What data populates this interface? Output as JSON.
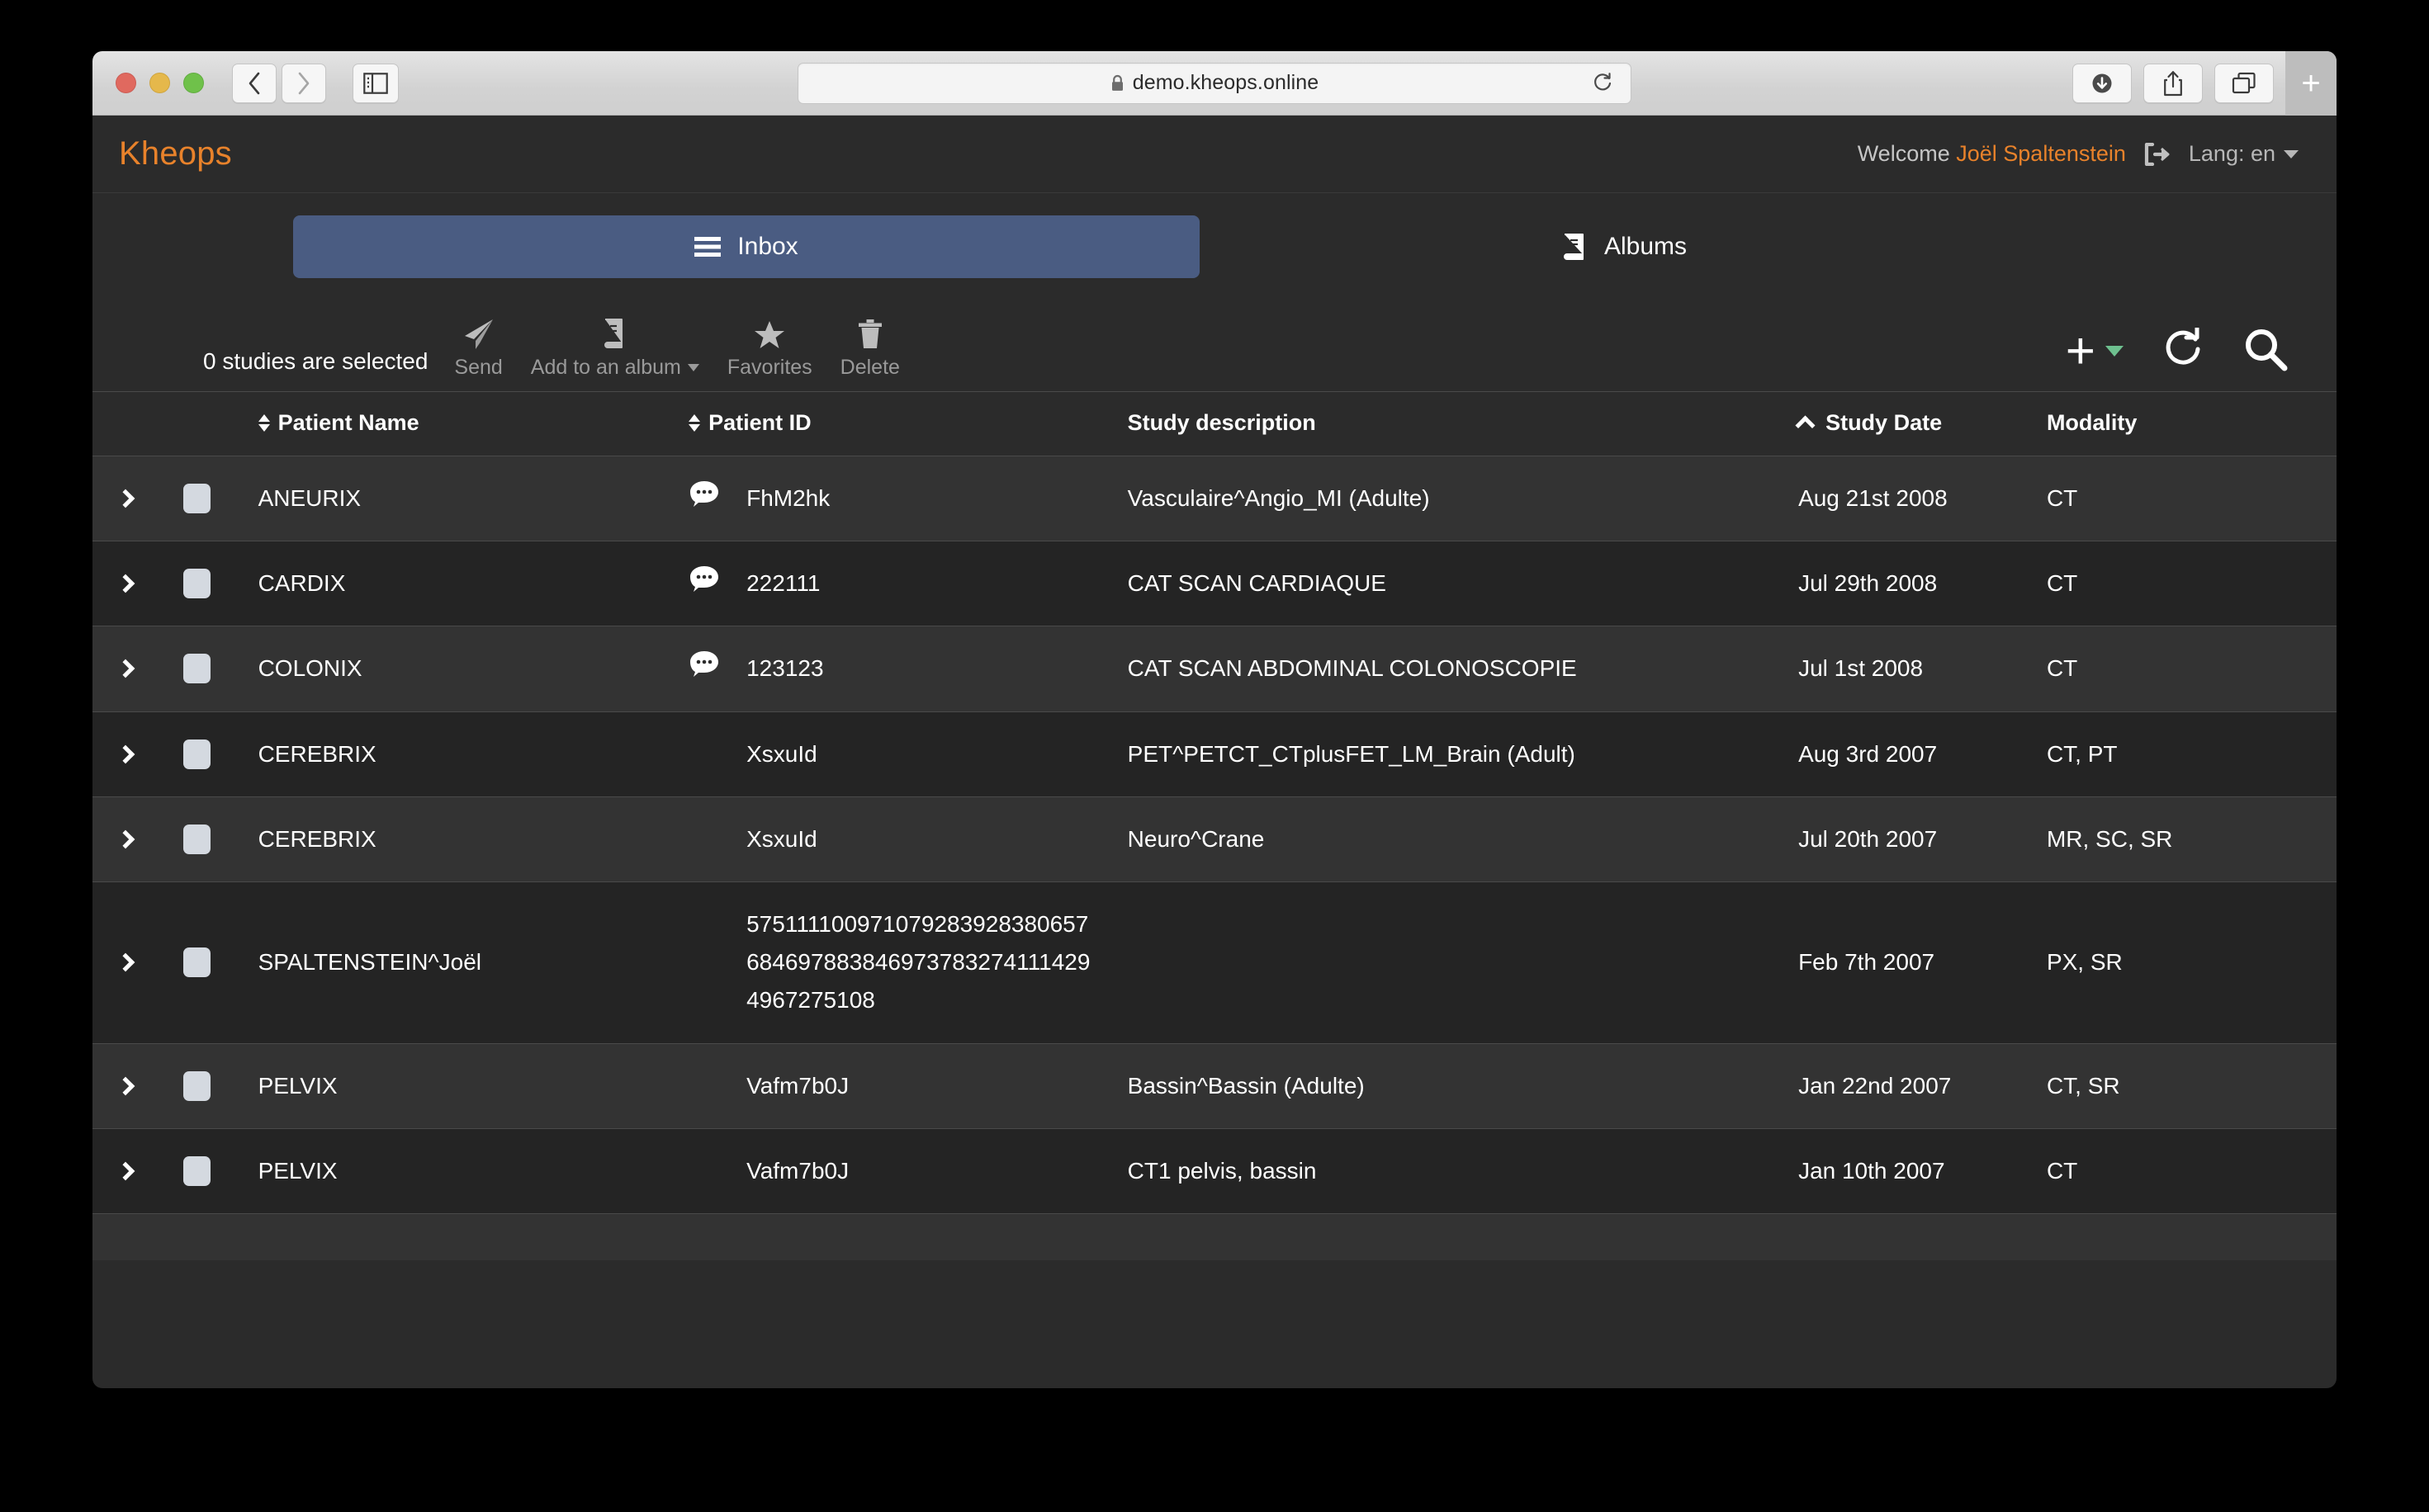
{
  "browser": {
    "url": "demo.kheops.online",
    "lock_icon": "lock-icon",
    "back_icon": "chevron-left-icon",
    "forward_icon": "chevron-right-icon",
    "sidebar_icon": "sidebar-toggle-icon",
    "reload_icon": "reload-icon",
    "downloads_icon": "downloads-icon",
    "share_icon": "share-icon",
    "tabs_icon": "tab-overview-icon",
    "new_tab_label": "+"
  },
  "header": {
    "brand": "Kheops",
    "welcome_prefix": "Welcome",
    "user_name": "Joël Spaltenstein",
    "logout_icon": "logout-icon",
    "lang_label": "Lang: en",
    "brand_color": "#e8822b"
  },
  "tabs": [
    {
      "label": "Inbox",
      "icon": "list-icon",
      "active": true
    },
    {
      "label": "Albums",
      "icon": "book-icon",
      "active": false
    }
  ],
  "toolbar": {
    "selection_status": "0 studies are selected",
    "actions": [
      {
        "label": "Send",
        "icon": "paper-plane-icon",
        "has_caret": false
      },
      {
        "label": "Add to an album",
        "icon": "book-icon",
        "has_caret": true
      },
      {
        "label": "Favorites",
        "icon": "star-icon",
        "has_caret": false
      },
      {
        "label": "Delete",
        "icon": "trash-icon",
        "has_caret": false
      }
    ],
    "add_icon": "plus-icon",
    "add_caret_color": "#6ec08f",
    "refresh_icon": "refresh-icon",
    "search_icon": "search-icon"
  },
  "table": {
    "columns": [
      {
        "label": "Patient Name",
        "sort": "both"
      },
      {
        "label": "Patient ID",
        "sort": "both"
      },
      {
        "label": "Study description",
        "sort": "none"
      },
      {
        "label": "Study Date",
        "sort": "asc"
      },
      {
        "label": "Modality",
        "sort": "none"
      }
    ],
    "rows": [
      {
        "patient_name": "ANEURIX",
        "patient_id": "FhM2hk",
        "has_comment": true,
        "study_description": "Vasculaire^Angio_MI (Adulte)",
        "study_date": "Aug 21st 2008",
        "modality": "CT"
      },
      {
        "patient_name": "CARDIX",
        "patient_id": "222111",
        "has_comment": true,
        "study_description": "CAT SCAN CARDIAQUE",
        "study_date": "Jul 29th 2008",
        "modality": "CT"
      },
      {
        "patient_name": "COLONIX",
        "patient_id": "123123",
        "has_comment": true,
        "study_description": "CAT SCAN ABDOMINAL COLONOSCOPIE",
        "study_date": "Jul 1st 2008",
        "modality": "CT"
      },
      {
        "patient_name": "CEREBRIX",
        "patient_id": "XsxuId",
        "has_comment": false,
        "study_description": "PET^PETCT_CTplusFET_LM_Brain (Adult)",
        "study_date": "Aug 3rd 2007",
        "modality": "CT, PT"
      },
      {
        "patient_name": "CEREBRIX",
        "patient_id": "XsxuId",
        "has_comment": false,
        "study_description": "Neuro^Crane",
        "study_date": "Jul 20th 2007",
        "modality": "MR, SC, SR"
      },
      {
        "patient_name": "SPALTENSTEIN^Joël",
        "patient_id": "575111100971079283928380657 684697883846973783274111429 4967275108",
        "has_comment": false,
        "study_description": "",
        "study_date": "Feb 7th 2007",
        "modality": "PX, SR"
      },
      {
        "patient_name": "PELVIX",
        "patient_id": "Vafm7b0J",
        "has_comment": false,
        "study_description": "Bassin^Bassin (Adulte)",
        "study_date": "Jan 22nd 2007",
        "modality": "CT, SR"
      },
      {
        "patient_name": "PELVIX",
        "patient_id": "Vafm7b0J",
        "has_comment": false,
        "study_description": "CT1 pelvis, bassin",
        "study_date": "Jan 10th 2007",
        "modality": "CT"
      }
    ]
  }
}
